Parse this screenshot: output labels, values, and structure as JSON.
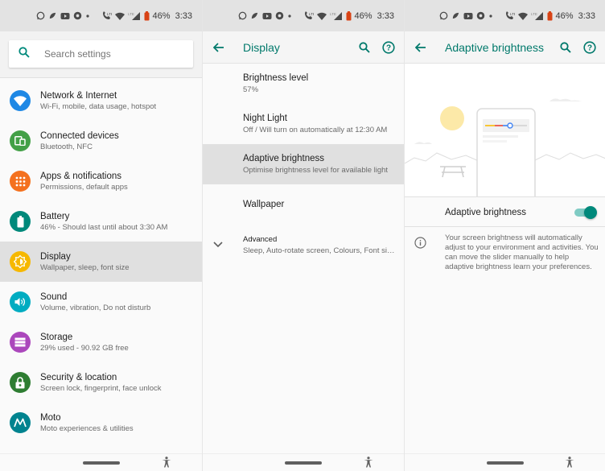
{
  "status_bar": {
    "battery": "46%",
    "time": "3:33"
  },
  "settings": {
    "search_placeholder": "Search settings",
    "items": [
      {
        "title": "Network & Internet",
        "subtitle": "Wi-Fi, mobile, data usage, hotspot",
        "icon": "wifi-icon",
        "color": "#1e88e5"
      },
      {
        "title": "Connected devices",
        "subtitle": "Bluetooth, NFC",
        "icon": "devices-icon",
        "color": "#43a047"
      },
      {
        "title": "Apps & notifications",
        "subtitle": "Permissions, default apps",
        "icon": "apps-grid-icon",
        "color": "#f4711e"
      },
      {
        "title": "Battery",
        "subtitle": "46% - Should last until about 3:30 AM",
        "icon": "battery-icon",
        "color": "#00897b"
      },
      {
        "title": "Display",
        "subtitle": "Wallpaper, sleep, font size",
        "icon": "brightness-icon",
        "color": "#f6b800"
      },
      {
        "title": "Sound",
        "subtitle": "Volume, vibration, Do not disturb",
        "icon": "volume-icon",
        "color": "#00acc1"
      },
      {
        "title": "Storage",
        "subtitle": "29% used - 90.92 GB free",
        "icon": "storage-icon",
        "color": "#ab47bc"
      },
      {
        "title": "Security & location",
        "subtitle": "Screen lock, fingerprint, face unlock",
        "icon": "lock-icon",
        "color": "#2e7d32"
      },
      {
        "title": "Moto",
        "subtitle": "Moto experiences & utilities",
        "icon": "moto-icon",
        "color": "#00838f"
      }
    ]
  },
  "display": {
    "title": "Display",
    "items": [
      {
        "title": "Brightness level",
        "subtitle": "57%"
      },
      {
        "title": "Night Light",
        "subtitle": "Off / Will turn on automatically at 12:30 AM"
      },
      {
        "title": "Adaptive brightness",
        "subtitle": "Optimise brightness level for available light"
      },
      {
        "title": "Wallpaper",
        "subtitle": ""
      },
      {
        "title": "Advanced",
        "subtitle": "Sleep, Auto-rotate screen, Colours, Font siz..."
      }
    ]
  },
  "adaptive": {
    "title": "Adaptive brightness",
    "toggle_label": "Adaptive brightness",
    "toggle_on": true,
    "description": "Your screen brightness will automatically adjust to your environment and activities. You can move the slider manually to help adaptive brightness learn your preferences."
  },
  "colors": {
    "accent": "#00796b",
    "toggle": "#00897b",
    "selected": "#e0e0e0"
  }
}
